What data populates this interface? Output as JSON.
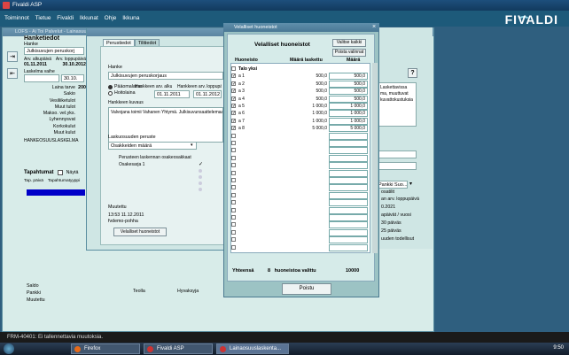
{
  "app": {
    "title": "Fivaldi ASP",
    "brand": "FIVALDI"
  },
  "menu": [
    "Toiminnot",
    "Tietue",
    "Fivaldi",
    "Ikkunat",
    "Ohje",
    "Ikkuna"
  ],
  "main_window": {
    "title": "LOFS - Ai Toi Palvelut - Lainasuunnitelmat / Nettopankkivapaatsiat-pohjat",
    "section_title": "Hanketiedot",
    "subtitle": "Hanke",
    "hanke_value": "Julkisuvujen peruskorj",
    "arv_alkupaiva_label": "Arv. alkupäivä",
    "arv_loppupaiva_label": "Arv. loppupäivä",
    "arv_alkupaiva": "01.11.2011",
    "arv_loppupaiva": "30.10.2012",
    "laskelma_vaihe_label": "Laskelma vaihe",
    "laskelma_vaihe_value": "30.10.",
    "rows": [
      "Laina tarve",
      "Sakio",
      "Vesiliiketulot",
      "Muut tulot",
      "Makso. vel.yks.",
      "Lyhennysvat",
      "Korkokulut",
      "Muut kulut"
    ],
    "laina_tarve_value": "200",
    "hankeosuus_label": "HANKEOSUUSLASKELMA",
    "tapahtumat_title": "Tapahtumat",
    "nayta_label": "Näytä",
    "tap_paiva_label": "Tap. päivä",
    "tapahtumatyyppi_label": "Tapahtumatyyppi",
    "bottom_labels": [
      "Saldo",
      "Pankki",
      "Muutettu"
    ],
    "bottom_labels2": [
      "Teolla",
      "Hyvaksyja"
    ]
  },
  "mid_window": {
    "tabs": [
      "Perustiedot",
      "Tilitiedot"
    ],
    "hanke_label": "Hanke",
    "hanke_value": "Julkisuvujen peruskorjaus",
    "radio_1": "Pääomalaina",
    "radio_2": "Hoitolaina",
    "arv_alkupaiva_label": "Hankkeen arv. alkupäivä",
    "arv_loppupaiva_label": "Hankkeen arv. loppupäivä",
    "arv_alkupaiva": "01.11.2011",
    "arv_loppupaiva": "01.11.2012",
    "hankkeen_kuvaus_label": "Hankkeen kuvaus",
    "hankkeen_kuvaus": "Valvojana toimii Vahanen Yhtymä. Julkisuvunsaattelemaa",
    "laskennan_peruste_label": "Laskuosuuden peruste",
    "laskennan_peruste_value": "Osakkeiden määrä",
    "perusteen_label": "Perusteen laskennan osakeosakkaat",
    "osakesarja_label": "Osakesarja 1",
    "muutettu_label": "Muutettu",
    "muutettu_value": "13:53 11.12.2011",
    "muutettu_user": "fvdemo-pohha",
    "velalliset_button": "Velalliset huoneistot"
  },
  "right_window": {
    "labels": [
      "Laskettavissa",
      "ma, muuttuvat",
      "kuvattokustuksia"
    ],
    "pankki_label": "Pankki Suo...",
    "items": [
      "osatilit",
      "an arv. loppupäivä",
      "0.2021",
      "apäivät / vuosi",
      "30 päiväs",
      "25 päiväs",
      "uuden todellisut"
    ]
  },
  "dialog": {
    "title": "Velalliset huoneistot",
    "heading": "Velalliset huoneistot",
    "valitse_button": "Valitse kaikki",
    "poista_button": "Poista valinnat",
    "col_huoneisto": "Huoneisto",
    "col_maara_laskettu": "Määrä laskettu",
    "col_maara": "Määrä",
    "talo_label": "Talo yksi",
    "rows": [
      {
        "name": "a 1",
        "checked": true,
        "laskettu": "500,0",
        "maara": "500,0"
      },
      {
        "name": "a 2",
        "checked": true,
        "laskettu": "500,0",
        "maara": "500,0"
      },
      {
        "name": "a 3",
        "checked": true,
        "laskettu": "500,0",
        "maara": "500,0"
      },
      {
        "name": "a 4",
        "checked": true,
        "laskettu": "500,0",
        "maara": "500,0"
      },
      {
        "name": "a 5",
        "checked": true,
        "laskettu": "1 000,0",
        "maara": "1 000,0"
      },
      {
        "name": "a 6",
        "checked": true,
        "laskettu": "1 000,0",
        "maara": "1 000,0"
      },
      {
        "name": "a 7",
        "checked": true,
        "laskettu": "1 000,0",
        "maara": "1 000,0"
      },
      {
        "name": "a 8",
        "checked": true,
        "laskettu": "5 000,0",
        "maara": "5 000,0"
      }
    ],
    "empty_row_count": 16,
    "yhteensa_label": "Yhteensä",
    "yhteensa_count": "8",
    "huoneistoa_valittu_label": "huoneistoa valittu",
    "yhteensa_value": "10000",
    "poistu_button": "Poistu"
  },
  "status": {
    "message": "FRM-40401: Ei tallennettavia muutoksia."
  },
  "taskbar": {
    "items": [
      "Firefox",
      "Fivaldi ASP",
      "Lainaosuuslaskenta..."
    ],
    "clock": "9:50"
  }
}
